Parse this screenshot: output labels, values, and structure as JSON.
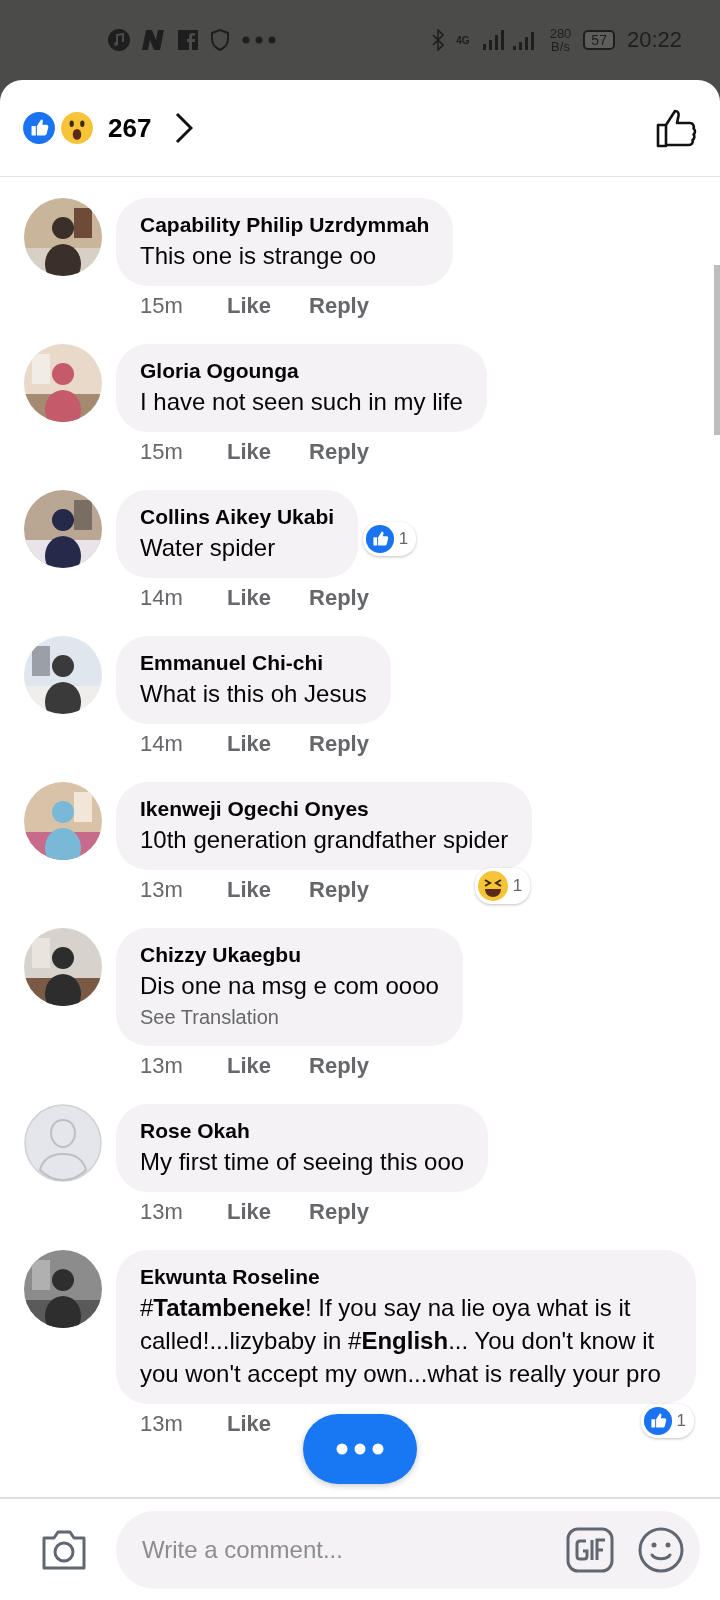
{
  "status_bar": {
    "speed_value": "280",
    "speed_unit": "B/s",
    "network": "4G",
    "battery": "57",
    "time": "20:22"
  },
  "header": {
    "reaction_count": "267"
  },
  "comments": [
    {
      "author": "Capability Philip Uzrdymmah",
      "text": "This one is strange oo",
      "time": "15m",
      "like": "Like",
      "reply": "Reply"
    },
    {
      "author": "Gloria Ogounga",
      "text": "I have not seen such in my life",
      "time": "15m",
      "like": "Like",
      "reply": "Reply"
    },
    {
      "author": "Collins Aikey Ukabi",
      "text": "Water spider",
      "time": "14m",
      "like": "Like",
      "reply": "Reply",
      "reaction": {
        "kind": "like",
        "count": "1",
        "beside_bubble": true
      }
    },
    {
      "author": "Emmanuel Chi-chi",
      "text": "What is this oh Jesus",
      "time": "14m",
      "like": "Like",
      "reply": "Reply"
    },
    {
      "author": "Ikenweji Ogechi Onyes",
      "text": "10th generation grandfather spider",
      "time": "13m",
      "like": "Like",
      "reply": "Reply",
      "reaction": {
        "kind": "haha",
        "count": "1",
        "beside_bubble": false
      }
    },
    {
      "author": "Chizzy Ukaegbu",
      "text": "Dis one na msg e com oooo",
      "translation": "See Translation",
      "time": "13m",
      "like": "Like",
      "reply": "Reply"
    },
    {
      "author": "Rose Okah",
      "text": "My first time of seeing  this ooo",
      "avatar": {
        "kind": "silhouette"
      },
      "time": "13m",
      "like": "Like",
      "reply": "Reply"
    },
    {
      "author": "Ekwunta Roseline",
      "text": "#**Tatambeneke**! If you say na lie oya what is it called!...lizybaby in #**English**... You don't know it you won't accept my own...what is really your pro",
      "time": "13m",
      "like": "Like",
      "reaction": {
        "kind": "like",
        "count": "1",
        "beside_bubble": false
      }
    }
  ],
  "composer": {
    "placeholder": "Write a comment..."
  }
}
